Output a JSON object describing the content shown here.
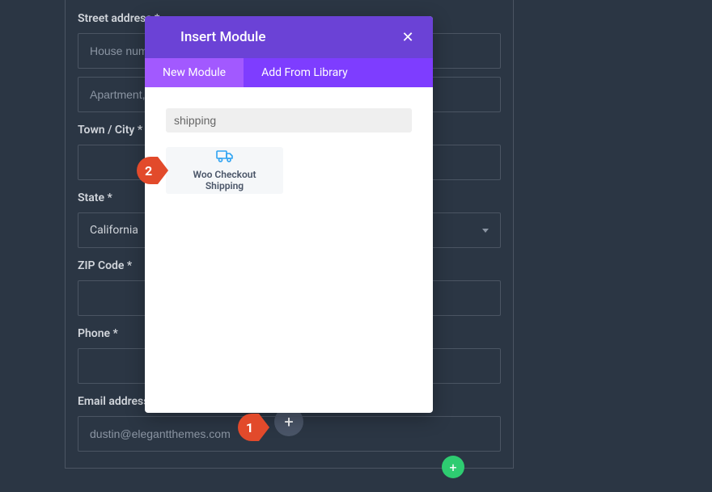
{
  "form": {
    "street_label": "Street address *",
    "street_placeholder1": "House number and street name",
    "street_placeholder2": "Apartment, suite, unit, etc. (optional)",
    "city_label": "Town / City *",
    "city_value": "",
    "state_label": "State *",
    "state_value": "California",
    "zip_label": "ZIP Code *",
    "zip_value": "",
    "phone_label": "Phone *",
    "phone_value": "",
    "email_label": "Email address *",
    "email_value": "dustin@elegantthemes.com"
  },
  "modal": {
    "title": "Insert Module",
    "tab_new": "New Module",
    "tab_library": "Add From Library",
    "search_value": "shipping",
    "module_line1": "Woo Checkout",
    "module_line2": "Shipping"
  },
  "callouts": {
    "one": "1",
    "two": "2"
  }
}
